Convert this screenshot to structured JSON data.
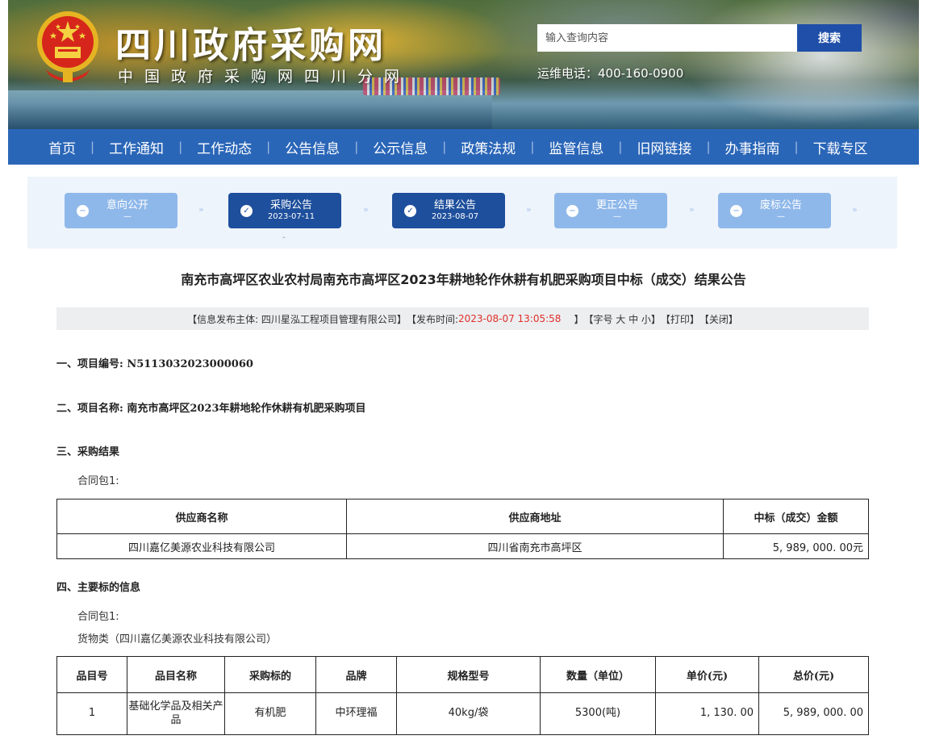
{
  "header": {
    "site_title": "四川政府采购网",
    "site_subtitle": "中国政府采购网四川分网",
    "search_placeholder": "输入查询内容",
    "search_button": "搜索",
    "hotline": "运维电话：400-160-0900"
  },
  "nav": [
    "首页",
    "工作通知",
    "工作动态",
    "公告信息",
    "公示信息",
    "政策法规",
    "监管信息",
    "旧网链接",
    "办事指南",
    "下载专区"
  ],
  "steps": [
    {
      "label": "意向公开",
      "sub": "—",
      "state": "inactive"
    },
    {
      "label": "采购公告",
      "sub": "2023-07-11",
      "state": "active"
    },
    {
      "label": "结果公告",
      "sub": "2023-08-07",
      "state": "active"
    },
    {
      "label": "更正公告",
      "sub": "—",
      "state": "inactive"
    },
    {
      "label": "废标公告",
      "sub": "—",
      "state": "inactive"
    }
  ],
  "article": {
    "title": "南充市高坪区农业农村局南充市高坪区2023年耕地轮作休耕有机肥采购项目中标（成交）结果公告",
    "meta": {
      "publisher": "【信息发布主体: 四川星泓工程项目管理有限公司】",
      "time_label": "【发布时间:",
      "time_value": "2023-08-07 13:05:58",
      "time_close": "】",
      "font_size": "【字号 大 中 小】",
      "print": "【打印】",
      "close": "【关闭】"
    },
    "sec1": "一、项目编号: N5113032023000060",
    "sec2": "二、项目名称: 南充市高坪区2023年耕地轮作休耕有机肥采购项目",
    "sec3": "三、采购结果",
    "package1": "合同包1:",
    "result_table": {
      "headers": [
        "供应商名称",
        "供应商地址",
        "中标（成交）金额"
      ],
      "row": [
        "四川嘉亿美源农业科技有限公司",
        "四川省南充市高坪区",
        "5, 989, 000. 00元"
      ]
    },
    "sec4": "四、主要标的信息",
    "package2": "合同包1:",
    "goods_type": "货物类（四川嘉亿美源农业科技有限公司）",
    "items_table": {
      "headers": [
        "品目号",
        "品目名称",
        "采购标的",
        "品牌",
        "规格型号",
        "数量（单位）",
        "单价(元)",
        "总价(元)"
      ],
      "row": [
        "1",
        "基础化学品及相关产品",
        "有机肥",
        "中环理福",
        "40kg/袋",
        "5300(吨)",
        "1, 130. 00",
        "5, 989, 000. 00"
      ]
    }
  },
  "colors": {
    "nav_bg": "#2a66b8",
    "step_active": "#1e4f9c",
    "step_inactive": "#8fb8ea",
    "time_red": "#e0302a"
  }
}
